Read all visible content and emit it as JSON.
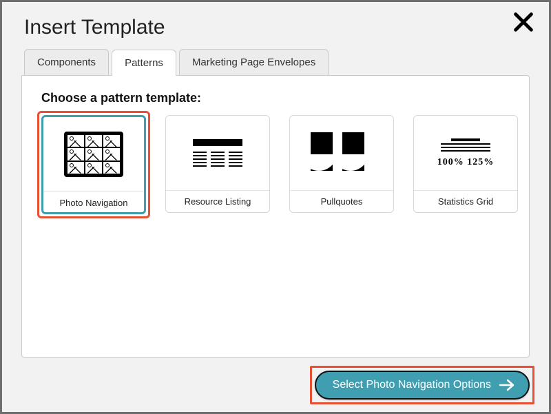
{
  "dialog": {
    "title": "Insert Template"
  },
  "tabs": {
    "components": "Components",
    "patterns": "Patterns",
    "marketing": "Marketing Page Envelopes"
  },
  "panel": {
    "heading": "Choose a pattern template:"
  },
  "patterns": {
    "photo_navigation": {
      "label": "Photo Navigation"
    },
    "resource_listing": {
      "label": "Resource Listing"
    },
    "pullquotes": {
      "label": "Pullquotes"
    },
    "statistics_grid": {
      "label": "Statistics Grid",
      "sample_values": "100%   125%"
    }
  },
  "action": {
    "select_label": "Select Photo Navigation Options"
  },
  "colors": {
    "accent_teal": "#3f9eaf",
    "highlight_red": "#e94f32"
  }
}
